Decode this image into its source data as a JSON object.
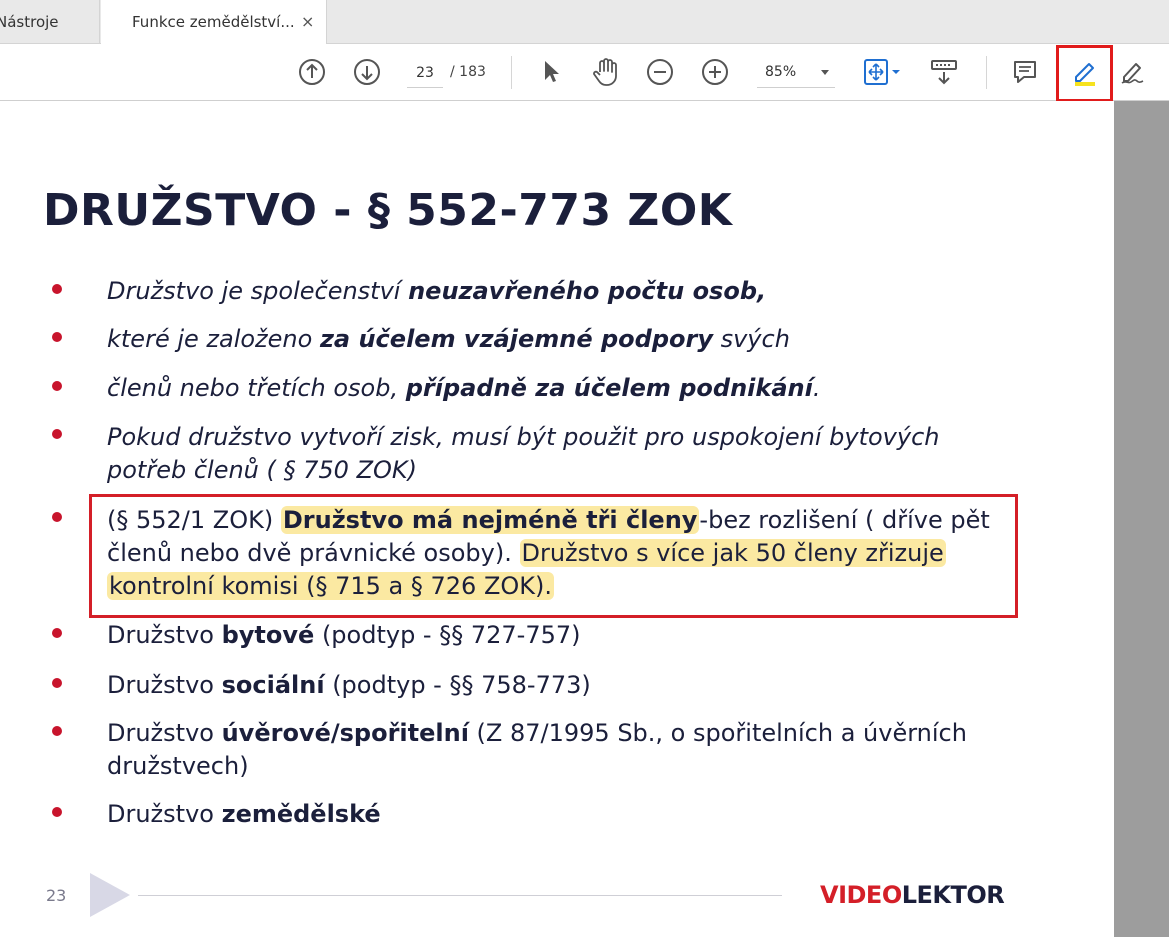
{
  "tabs": [
    {
      "label": "Nástroje"
    },
    {
      "label": "Funkce zemědělství..."
    }
  ],
  "tab_close_glyph": "×",
  "toolbar": {
    "page_current": "23",
    "page_total": "/ 183",
    "zoom": "85%",
    "icons": [
      "scroll-up-icon",
      "scroll-down-icon",
      "select-cursor-icon",
      "hand-pan-icon",
      "zoom-out-icon",
      "zoom-in-icon",
      "fit-page-icon",
      "read-mode-icon",
      "comment-icon",
      "highlight-pen-icon",
      "sign-pen-icon"
    ],
    "annotation_color": "#e11b1b"
  },
  "slide": {
    "title": "DRUŽSTVO - § 552-773 ZOK",
    "bullets": [
      {
        "segments": [
          {
            "t": "Družstvo je společenství ",
            "s": "it"
          },
          {
            "t": "neuzavřeného počtu osob",
            "s": "it b"
          },
          {
            "t": ",",
            "s": "it b"
          }
        ]
      },
      {
        "segments": [
          {
            "t": "které je založeno ",
            "s": "it"
          },
          {
            "t": "za účelem vzájemné podpory",
            "s": "it b"
          },
          {
            "t": " svých",
            "s": "it"
          }
        ]
      },
      {
        "segments": [
          {
            "t": "členů nebo třetích osob, ",
            "s": "it"
          },
          {
            "t": "případně za účelem podnikání",
            "s": "it b"
          },
          {
            "t": ".",
            "s": "it"
          }
        ]
      },
      {
        "lines": [
          [
            {
              "t": "Pokud družstvo vytvoří zisk, musí být použit pro uspokojení bytových",
              "s": "it"
            }
          ],
          [
            {
              "t": "potřeb členů ( § 750 ZOK)",
              "s": "it"
            }
          ]
        ]
      },
      {
        "lines": [
          [
            {
              "t": "(§ 552/1 ZOK) ",
              "s": ""
            },
            {
              "t": "Družstvo má nejméně tři členy",
              "s": "b hl"
            },
            {
              "t": "-bez rozlišení ( dříve pět",
              "s": ""
            }
          ],
          [
            {
              "t": "členů nebo dvě právnické osoby). ",
              "s": ""
            },
            {
              "t": "Družstvo s více jak 50 členy zřizuje",
              "s": "hl"
            }
          ],
          [
            {
              "t": "kontrolní komisi (§ 715 a § 726 ZOK).",
              "s": "hl"
            }
          ]
        ]
      },
      {
        "segments": [
          {
            "t": "Družstvo ",
            "s": ""
          },
          {
            "t": "bytové",
            "s": "b"
          },
          {
            "t": " (podtyp - §§ 727-757)",
            "s": ""
          }
        ]
      },
      {
        "segments": [
          {
            "t": "Družstvo ",
            "s": ""
          },
          {
            "t": "sociální",
            "s": "b"
          },
          {
            "t": " (podtyp - §§ 758-773)",
            "s": ""
          }
        ]
      },
      {
        "lines": [
          [
            {
              "t": "Družstvo ",
              "s": ""
            },
            {
              "t": "úvěrové/spořitelní",
              "s": "b"
            },
            {
              "t": " (Z 87/1995 Sb., o spořitelních a úvěrních",
              "s": ""
            }
          ],
          [
            {
              "t": "družstvech)",
              "s": ""
            }
          ]
        ]
      },
      {
        "segments": [
          {
            "t": "Družstvo ",
            "s": ""
          },
          {
            "t": "zemědělské",
            "s": "b"
          }
        ]
      }
    ],
    "page_number": "23",
    "logo_red": "VIDEO",
    "logo_navy": "LEKTOR"
  }
}
